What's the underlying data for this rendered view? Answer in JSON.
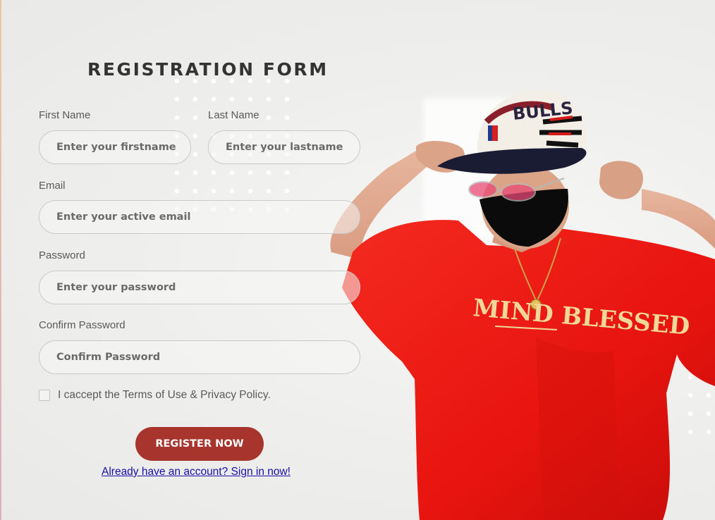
{
  "form": {
    "title": "REGISTRATION FORM",
    "first_name": {
      "label": "First Name",
      "placeholder": "Enter your firstname"
    },
    "last_name": {
      "label": "Last Name",
      "placeholder": "Enter your lastname"
    },
    "email": {
      "label": "Email",
      "placeholder": "Enter your active email"
    },
    "password": {
      "label": "Password",
      "placeholder": "Enter your password"
    },
    "confirm_password": {
      "label": "Confirm Password",
      "placeholder": "Confirm Password"
    },
    "terms_label": "I caccept the Terms of Use & Privacy Policy.",
    "register_label": "REGISTER NOW",
    "signin_link": "Already have an account? Sign in now!"
  },
  "hero": {
    "shirt_text": "MIND BLESSED",
    "cap_text": "BULLS"
  },
  "colors": {
    "accent": "#a8352d",
    "link": "#1a0dab",
    "shirt": "#ee1a14"
  }
}
